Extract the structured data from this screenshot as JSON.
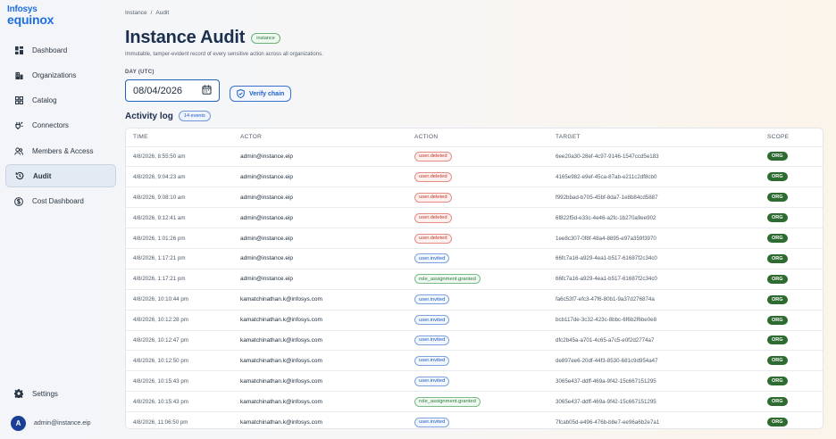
{
  "brand": {
    "line1": "Infosys",
    "line2": "equinox",
    "color": "#1f6fe0"
  },
  "sidebar": {
    "items": [
      {
        "label": "Dashboard",
        "icon": "dashboard-icon"
      },
      {
        "label": "Organizations",
        "icon": "building-icon"
      },
      {
        "label": "Catalog",
        "icon": "grid-icon"
      },
      {
        "label": "Connectors",
        "icon": "plug-icon"
      },
      {
        "label": "Members & Access",
        "icon": "users-icon"
      },
      {
        "label": "Audit",
        "icon": "history-icon",
        "active": true
      },
      {
        "label": "Cost Dashboard",
        "icon": "dollar-icon"
      }
    ],
    "settings_label": "Settings",
    "user": {
      "initial": "A",
      "email": "admin@instance.eip"
    }
  },
  "breadcrumb": {
    "root": "Instance",
    "separator": "/",
    "current": "Audit"
  },
  "header": {
    "title": "Instance Audit",
    "scope_badge": "instance",
    "subtitle": "Immutable, tamper-evident record of every sensitive action across all organizations."
  },
  "filters": {
    "day_label": "DAY (UTC)",
    "date_value": "08/04/2026",
    "verify_label": "Verify chain"
  },
  "log": {
    "title": "Activity log",
    "count_badge": "14 events",
    "columns": [
      "TIME",
      "ACTOR",
      "ACTION",
      "TARGET",
      "SCOPE"
    ],
    "rows": [
      {
        "time": "4/8/2026, 8:55:50 am",
        "actor": "admin@instance.eip",
        "action": "user.deleted",
        "kind": "deleted",
        "target": "6ee20a30-28ef-4c97-9146-1547ccd5e183",
        "scope": "ORG"
      },
      {
        "time": "4/8/2026, 9:04:23 am",
        "actor": "admin@instance.eip",
        "action": "user.deleted",
        "kind": "deleted",
        "target": "4165e982-e9ef-45ca-87ab-e211c2df8cb0",
        "scope": "ORG"
      },
      {
        "time": "4/8/2026, 9:08:10 am",
        "actor": "admin@instance.eip",
        "action": "user.deleted",
        "kind": "deleted",
        "target": "f992bbad-b705-45bf-8da7-1e8b84cd5887",
        "scope": "ORG"
      },
      {
        "time": "4/8/2026, 9:12:41 am",
        "actor": "admin@instance.eip",
        "action": "user.deleted",
        "kind": "deleted",
        "target": "6f822f5d-e33c-4e46-a2fc-1b270a9ee902",
        "scope": "ORG"
      },
      {
        "time": "4/8/2026, 1:01:26 pm",
        "actor": "admin@instance.eip",
        "action": "user.deleted",
        "kind": "deleted",
        "target": "1ee8c307-0f8f-48a4-8895-e97a359f3970",
        "scope": "ORG"
      },
      {
        "time": "4/8/2026, 1:17:21 pm",
        "actor": "admin@instance.eip",
        "action": "user.invited",
        "kind": "invited",
        "target": "66fc7a16-a929-4ea1-b517-61687f2c34c0",
        "scope": "ORG"
      },
      {
        "time": "4/8/2026, 1:17:21 pm",
        "actor": "admin@instance.eip",
        "action": "role_assignment.granted",
        "kind": "granted",
        "target": "66fc7a16-a929-4ea1-b517-61687f2c34c0",
        "scope": "ORG"
      },
      {
        "time": "4/8/2026, 10:10:44 pm",
        "actor": "kamatchinathan.k@infosys.com",
        "action": "user.invited",
        "kind": "invited",
        "target": "fa6c53f7-efc3-47f6-80b1-9a37d276874a",
        "scope": "ORG"
      },
      {
        "time": "4/8/2026, 10:12:28 pm",
        "actor": "kamatchinathan.k@infosys.com",
        "action": "user.invited",
        "kind": "invited",
        "target": "bcb117de-3c32-423c-8bbc-6f6b2f6be0e8",
        "scope": "ORG"
      },
      {
        "time": "4/8/2026, 10:12:47 pm",
        "actor": "kamatchinathan.k@infosys.com",
        "action": "user.invited",
        "kind": "invited",
        "target": "dfc2b45a-a701-4c65-a7c5-e0f2d2774a7",
        "scope": "ORG"
      },
      {
        "time": "4/8/2026, 10:12:50 pm",
        "actor": "kamatchinathan.k@infosys.com",
        "action": "user.invited",
        "kind": "invited",
        "target": "de897ee6-20df-44f3-8530-681c9d954a47",
        "scope": "ORG"
      },
      {
        "time": "4/8/2026, 10:15:43 pm",
        "actor": "kamatchinathan.k@infosys.com",
        "action": "user.invited",
        "kind": "invited",
        "target": "3065e437-ddff-469a-9f42-15c667151295",
        "scope": "ORG"
      },
      {
        "time": "4/8/2026, 10:15:43 pm",
        "actor": "kamatchinathan.k@infosys.com",
        "action": "role_assignment.granted",
        "kind": "granted",
        "target": "3065e437-ddff-469a-9f42-15c667151295",
        "scope": "ORG"
      },
      {
        "time": "4/8/2026, 11:06:50 pm",
        "actor": "kamatchinathan.k@infosys.com",
        "action": "user.invited",
        "kind": "invited",
        "target": "7fcab05d-e496-476b-b8e7-ee96a6b2e7a1",
        "scope": "ORG"
      }
    ]
  },
  "colors": {
    "accent": "#1f5fbf",
    "deleted": "#c0392b",
    "granted": "#2f7a3e",
    "scope_badge": "#2e6b31"
  }
}
